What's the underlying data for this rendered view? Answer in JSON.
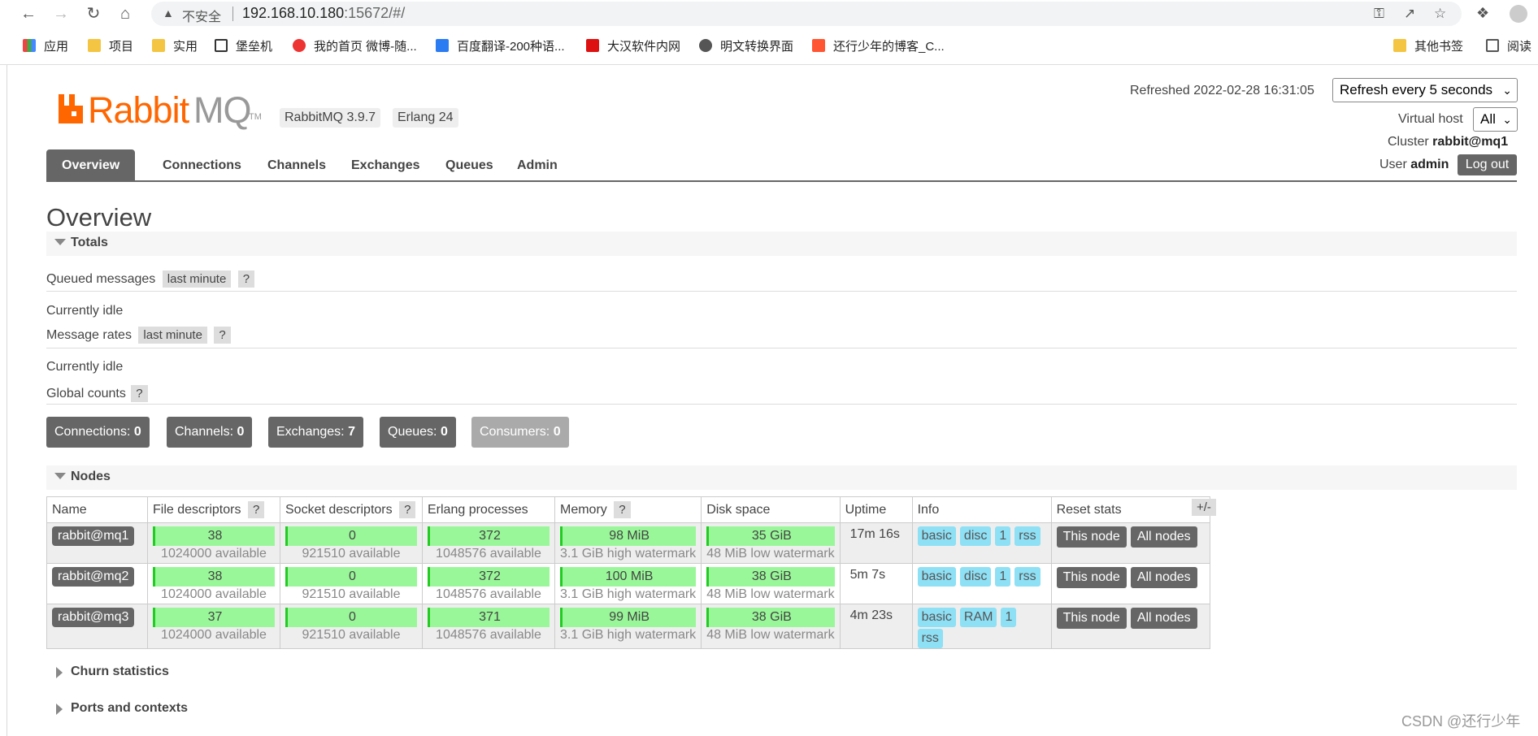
{
  "browser": {
    "insecure_label": "不安全",
    "url_host": "192.168.10.180",
    "url_rest": ":15672/#/",
    "bookmarks": [
      "应用",
      "项目",
      "实用",
      "堡垒机",
      "我的首页 微博-随...",
      "百度翻译-200种语...",
      "大汉软件内网",
      "明文转换界面",
      "还行少年的博客_C...",
      "其他书签",
      "阅读"
    ]
  },
  "header": {
    "logo_rabbit": "Rabbit",
    "logo_mq": "MQ",
    "logo_tm": "TM",
    "version": "RabbitMQ 3.9.7",
    "erlang": "Erlang 24",
    "refreshed": "Refreshed 2022-02-28 16:31:05",
    "refresh_select": "Refresh every 5 seconds",
    "vhost_label": "Virtual host",
    "vhost_value": "All",
    "cluster_label": "Cluster",
    "cluster_value": "rabbit@mq1",
    "user_label": "User",
    "user_value": "admin",
    "logout": "Log out"
  },
  "tabs": [
    "Overview",
    "Connections",
    "Channels",
    "Exchanges",
    "Queues",
    "Admin"
  ],
  "page_title": "Overview",
  "totals": {
    "heading": "Totals",
    "queued_messages": "Queued messages",
    "last_minute": "last minute",
    "help": "?",
    "idle1": "Currently idle",
    "message_rates": "Message rates",
    "idle2": "Currently idle",
    "global_counts": "Global counts"
  },
  "counts": [
    {
      "label": "Connections:",
      "value": "0"
    },
    {
      "label": "Channels:",
      "value": "0"
    },
    {
      "label": "Exchanges:",
      "value": "7"
    },
    {
      "label": "Queues:",
      "value": "0"
    },
    {
      "label": "Consumers:",
      "value": "0"
    }
  ],
  "nodes": {
    "heading": "Nodes",
    "plusminus": "+/-",
    "columns": [
      "Name",
      "File descriptors",
      "Socket descriptors",
      "Erlang processes",
      "Memory",
      "Disk space",
      "Uptime",
      "Info",
      "Reset stats"
    ],
    "rows": [
      {
        "name": "rabbit@mq1",
        "fd": "38",
        "fd_avail": "1024000 available",
        "sd": "0",
        "sd_avail": "921510 available",
        "ep": "372",
        "ep_avail": "1048576 available",
        "mem": "98 MiB",
        "mem_wm": "3.1 GiB high watermark",
        "disk": "35 GiB",
        "disk_wm": "48 MiB low watermark",
        "uptime": "17m 16s",
        "info": [
          "basic",
          "disc",
          "1",
          "rss"
        ],
        "reset": [
          "This node",
          "All nodes"
        ]
      },
      {
        "name": "rabbit@mq2",
        "fd": "38",
        "fd_avail": "1024000 available",
        "sd": "0",
        "sd_avail": "921510 available",
        "ep": "372",
        "ep_avail": "1048576 available",
        "mem": "100 MiB",
        "mem_wm": "3.1 GiB high watermark",
        "disk": "38 GiB",
        "disk_wm": "48 MiB low watermark",
        "uptime": "5m 7s",
        "info": [
          "basic",
          "disc",
          "1",
          "rss"
        ],
        "reset": [
          "This node",
          "All nodes"
        ]
      },
      {
        "name": "rabbit@mq3",
        "fd": "37",
        "fd_avail": "1024000 available",
        "sd": "0",
        "sd_avail": "921510 available",
        "ep": "371",
        "ep_avail": "1048576 available",
        "mem": "99 MiB",
        "mem_wm": "3.1 GiB high watermark",
        "disk": "38 GiB",
        "disk_wm": "48 MiB low watermark",
        "uptime": "4m 23s",
        "info": [
          "basic",
          "RAM",
          "1",
          "rss"
        ],
        "reset": [
          "This node",
          "All nodes"
        ]
      }
    ]
  },
  "churn": "Churn statistics",
  "ports": "Ports and contexts",
  "watermark": "CSDN @还行少年"
}
